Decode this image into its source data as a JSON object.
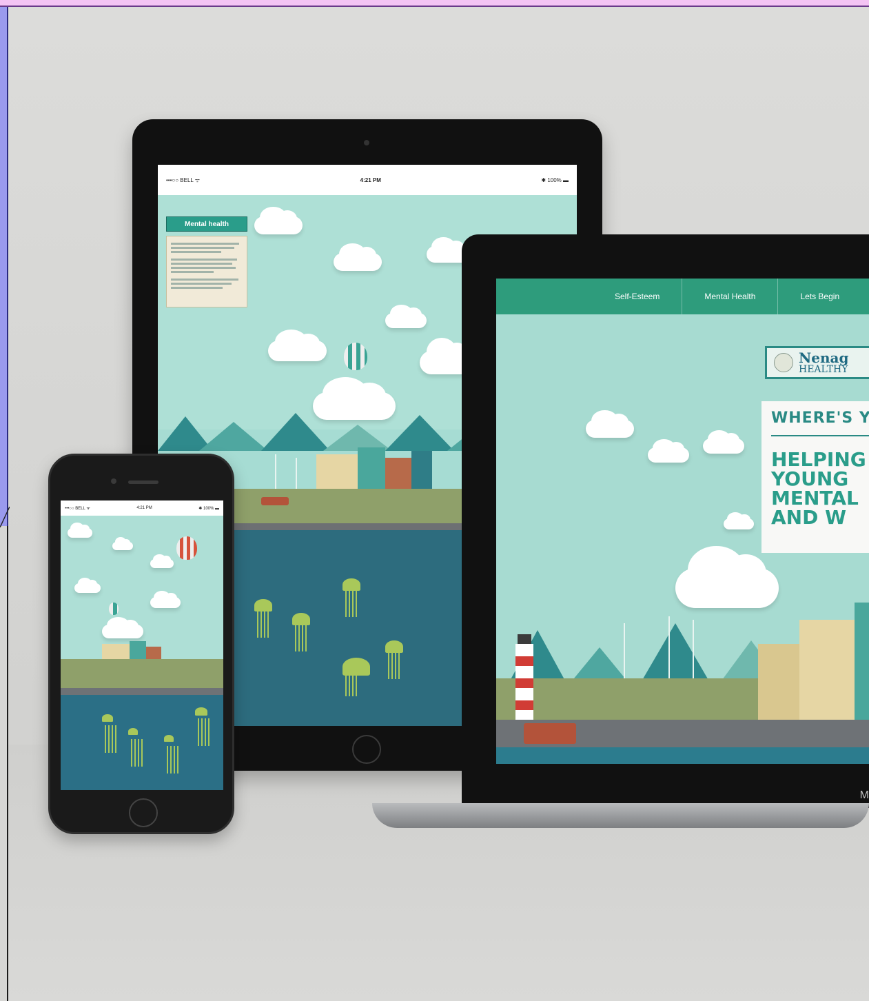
{
  "tablet": {
    "status": {
      "carrier": "•••○○ BELL ᯤ",
      "time": "4:21 PM",
      "battery": "✱ 100% ▬"
    },
    "content_title": "Mental health"
  },
  "laptop": {
    "nav": [
      {
        "label": "Self-Esteem"
      },
      {
        "label": "Mental Health"
      },
      {
        "label": "Lets Begin"
      }
    ],
    "logo": {
      "line1": "Nenag",
      "line2": "HEALTHY"
    },
    "headline_question": "WHERE'S YO",
    "headline_lines": [
      "HELPING T",
      "YOUNG",
      "MENTAL",
      "AND W"
    ],
    "bezel_label": "M"
  },
  "phone": {
    "status": {
      "carrier": "•••○○ BELL ᯤ",
      "time": "4:21 PM",
      "battery": "✱ 100% ▬"
    }
  },
  "colors": {
    "nav_green": "#2e9c7c",
    "sky": "#a7dbd1",
    "sea": "#2d6c7e",
    "accent_teal": "#2a8a84",
    "page_background": "#d6d6d4",
    "top_strip": "#f4c4f4",
    "left_panel": "#9a9aee"
  }
}
